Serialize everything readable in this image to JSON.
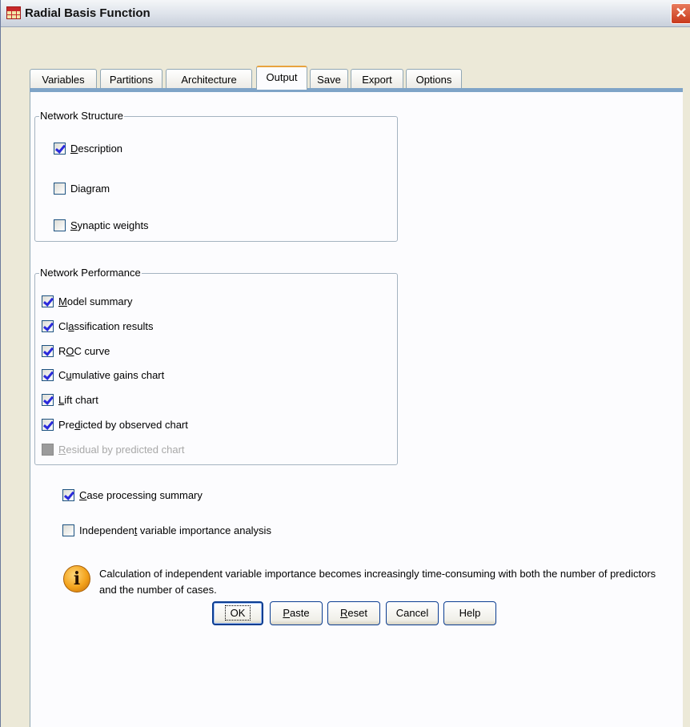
{
  "window": {
    "title": "Radial Basis Function",
    "close_glyph": "✕"
  },
  "tabs": [
    {
      "label": "Variables",
      "active": false
    },
    {
      "label": "Partitions",
      "active": false
    },
    {
      "label": "Architecture",
      "active": false
    },
    {
      "label": "Output",
      "active": true
    },
    {
      "label": "Save",
      "active": false
    },
    {
      "label": "Export",
      "active": false
    },
    {
      "label": "Options",
      "active": false
    }
  ],
  "network_structure": {
    "legend": "Network Structure",
    "items": [
      {
        "pre": "",
        "key": "D",
        "post": "escription",
        "checked": true,
        "enabled": true
      },
      {
        "pre": "Dia",
        "key": "g",
        "post": "ram",
        "checked": false,
        "enabled": true
      },
      {
        "pre": "",
        "key": "S",
        "post": "ynaptic weights",
        "checked": false,
        "enabled": true
      }
    ]
  },
  "network_performance": {
    "legend": "Network Performance",
    "items": [
      {
        "pre": "",
        "key": "M",
        "post": "odel summary",
        "checked": true,
        "enabled": true
      },
      {
        "pre": "Cl",
        "key": "a",
        "post": "ssification results",
        "checked": true,
        "enabled": true
      },
      {
        "pre": "R",
        "key": "O",
        "post": "C curve",
        "checked": true,
        "enabled": true
      },
      {
        "pre": "C",
        "key": "u",
        "post": "mulative gains chart",
        "checked": true,
        "enabled": true
      },
      {
        "pre": "",
        "key": "L",
        "post": "ift chart",
        "checked": true,
        "enabled": true
      },
      {
        "pre": "Pre",
        "key": "d",
        "post": "icted by observed chart",
        "checked": true,
        "enabled": true
      },
      {
        "pre": "",
        "key": "R",
        "post": "esidual by predicted chart",
        "checked": false,
        "enabled": false
      }
    ]
  },
  "extra": {
    "case_processing": {
      "pre": "",
      "key": "C",
      "post": "ase processing summary",
      "checked": true
    },
    "importance": {
      "pre": "Independen",
      "key": "t",
      "post": " variable importance analysis",
      "checked": false
    }
  },
  "info": {
    "icon": "info-icon",
    "icon_glyph": "i",
    "text": "Calculation of independent variable importance becomes increasingly time-consuming with both the number of predictors and the number of cases."
  },
  "buttons": {
    "ok": "OK",
    "paste": {
      "pre": "",
      "key": "P",
      "post": "aste"
    },
    "reset": {
      "pre": "",
      "key": "R",
      "post": "eset"
    },
    "cancel": "Cancel",
    "help": "Help"
  },
  "colors": {
    "tab_strip": "#7fa4c7",
    "active_tab_accent": "#e8a33e",
    "check_mark": "#2a2adb",
    "close_button": "#c8391b"
  }
}
